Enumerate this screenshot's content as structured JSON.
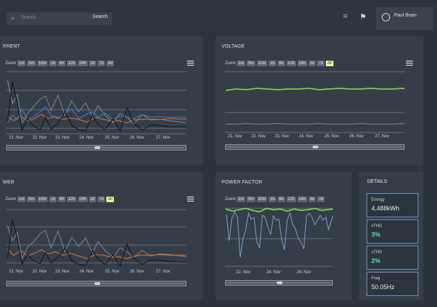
{
  "search": {
    "placeholder": "Search...",
    "button_label": "Search"
  },
  "header": {
    "user_name": "Paul Brain"
  },
  "panels": {
    "current": {
      "title": "RRENT",
      "zoom_label": "Zoom",
      "zoom_buttons": [
        "1m",
        "5m",
        "10m",
        "1h",
        "6h",
        "12h",
        "24h",
        "2d",
        "7d",
        "All"
      ],
      "active": "All",
      "x_ticks": [
        "21. Nov",
        "22. Nov",
        "23. Nov",
        "24. Nov",
        "25. Nov",
        "26. Nov",
        "27. Nov"
      ]
    },
    "voltage": {
      "title": "VOLTAGE",
      "zoom_label": "Zoom",
      "zoom_buttons": [
        "1m",
        "5m",
        "10m",
        "1h",
        "6h",
        "12h",
        "24h",
        "2d",
        "7d",
        "All"
      ],
      "active": "All",
      "x_ticks": [
        "21. Nov",
        "22. Nov",
        "23. Nov",
        "24. Nov",
        "25. Nov",
        "26. Nov",
        "27. Nov"
      ]
    },
    "power": {
      "title": "WER",
      "zoom_label": "Zoom",
      "zoom_buttons": [
        "1m",
        "5m",
        "10m",
        "1h",
        "6h",
        "12h",
        "24h",
        "2d",
        "7d",
        "All"
      ],
      "active": "All",
      "x_ticks": [
        "21. Nov",
        "22. Nov",
        "23. Nov",
        "24. Nov",
        "25. Nov",
        "26. Nov",
        "27. Nov"
      ]
    },
    "power_factor": {
      "title": "POWER FACTOR",
      "zoom_label": "Zoom",
      "zoom_buttons": [
        "1m",
        "5m",
        "10m",
        "1h",
        "6h",
        "12h",
        "24h",
        "2d",
        "7d"
      ],
      "active": "All",
      "x_ticks": [
        "22. Nov",
        "24. Nov",
        "26. Nov"
      ]
    }
  },
  "details": {
    "title": "DETAILS",
    "cards": [
      {
        "label": "Energy",
        "value": "4,488kWh",
        "accent": false
      },
      {
        "label": "vTHD",
        "value": "3%",
        "accent": true
      },
      {
        "label": "cTHD",
        "value": "2%",
        "accent": true
      },
      {
        "label": "Freq",
        "value": "50.05Hz",
        "accent": false
      }
    ]
  },
  "chart_data": [
    {
      "type": "line",
      "title": "RRENT",
      "x": [
        "21. Nov",
        "22. Nov",
        "23. Nov",
        "24. Nov",
        "25. Nov",
        "26. Nov",
        "27. Nov"
      ],
      "series": [
        {
          "values": [
            1.0,
            0.55,
            0.6,
            0.52,
            0.56,
            0.48,
            0.46
          ]
        },
        {
          "values": [
            0.8,
            0.65,
            0.7,
            0.62,
            0.67,
            0.6,
            0.58
          ]
        },
        {
          "values": [
            0.4,
            0.35,
            0.45,
            0.3,
            0.33,
            0.28,
            0.26
          ]
        }
      ]
    },
    {
      "type": "line",
      "title": "VOLTAGE",
      "x": [
        "21. Nov",
        "22. Nov",
        "23. Nov",
        "24. Nov",
        "25. Nov",
        "26. Nov",
        "27. Nov"
      ],
      "series": [
        {
          "values": [
            1.0,
            1.0,
            1.0,
            1.0,
            1.0,
            1.0,
            1.0
          ]
        },
        {
          "values": [
            0.35,
            0.35,
            0.35,
            0.35,
            0.35,
            0.35,
            0.35
          ]
        }
      ]
    },
    {
      "type": "line",
      "title": "WER",
      "x": [
        "21. Nov",
        "22. Nov",
        "23. Nov",
        "24. Nov",
        "25. Nov",
        "26. Nov",
        "27. Nov"
      ],
      "series": [
        {
          "values": [
            0.9,
            0.55,
            0.65,
            0.47,
            0.52,
            0.46,
            0.41
          ]
        },
        {
          "values": [
            0.6,
            0.42,
            0.5,
            0.38,
            0.4,
            0.37,
            0.32
          ]
        }
      ]
    },
    {
      "type": "line",
      "title": "POWER FACTOR",
      "x": [
        "22. Nov",
        "24. Nov",
        "26. Nov"
      ],
      "series": [
        {
          "values": [
            0.98,
            0.97,
            0.96
          ]
        },
        {
          "values": [
            0.72,
            0.68,
            0.65
          ]
        }
      ]
    }
  ]
}
